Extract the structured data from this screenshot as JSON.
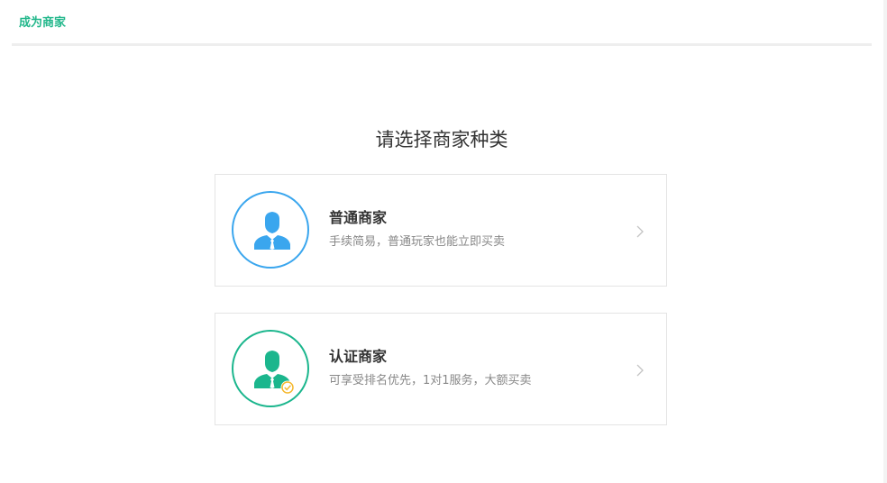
{
  "header": {
    "title": "成为商家"
  },
  "page": {
    "heading": "请选择商家种类"
  },
  "options": [
    {
      "title": "普通商家",
      "description": "手续简易，普通玩家也能立即买卖",
      "icon": "merchant-avatar-icon",
      "accent_color": "#3aa6ee"
    },
    {
      "title": "认证商家",
      "description": "可享受排名优先，1对1服务，大额买卖",
      "icon": "verified-merchant-avatar-icon",
      "accent_color": "#1bb68d",
      "badge_color": "#f5b82e"
    }
  ]
}
